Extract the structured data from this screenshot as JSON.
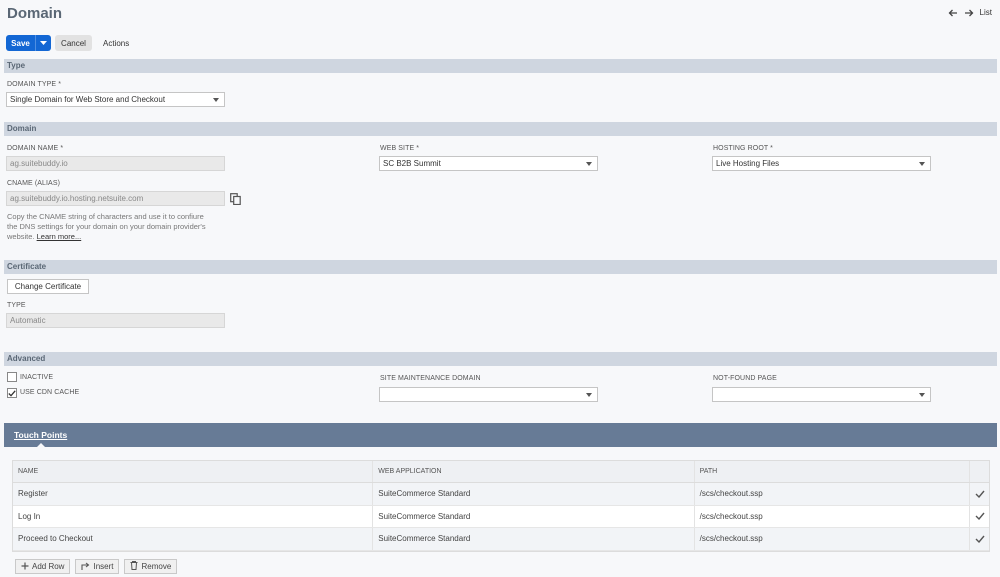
{
  "header": {
    "title": "Domain",
    "list_label": "List"
  },
  "toolbar": {
    "save_label": "Save",
    "cancel_label": "Cancel",
    "actions_label": "Actions"
  },
  "sections": {
    "type": {
      "title": "Type",
      "domain_type_label": "DOMAIN TYPE *",
      "domain_type_value": "Single Domain for Web Store and Checkout"
    },
    "domain": {
      "title": "Domain",
      "domain_name_label": "DOMAIN NAME *",
      "domain_name_value": "ag.suitebuddy.io",
      "cname_label": "CNAME (ALIAS)",
      "cname_value": "ag.suitebuddy.io.hosting.netsuite.com",
      "help_text": "Copy the CNAME string of characters and use it to confiure the DNS settings for your domain on your domain provider's website.",
      "help_link": "Learn more...",
      "website_label": "WEB SITE *",
      "website_value": "SC B2B Summit",
      "hosting_root_label": "HOSTING ROOT *",
      "hosting_root_value": "Live Hosting Files"
    },
    "certificate": {
      "title": "Certificate",
      "change_button": "Change Certificate",
      "type_label": "TYPE",
      "type_value": "Automatic"
    },
    "advanced": {
      "title": "Advanced",
      "inactive_label": "INACTIVE",
      "inactive_checked": false,
      "cdn_label": "USE CDN CACHE",
      "cdn_checked": true,
      "maintenance_label": "SITE MAINTENANCE DOMAIN",
      "maintenance_value": "",
      "notfound_label": "NOT-FOUND PAGE",
      "notfound_value": ""
    }
  },
  "touch_points": {
    "tab_label": "Touch Points",
    "columns": [
      "NAME",
      "WEB APPLICATION",
      "PATH"
    ],
    "rows": [
      {
        "name": "Register",
        "app": "SuiteCommerce Standard",
        "path": "/scs/checkout.ssp"
      },
      {
        "name": "Log In",
        "app": "SuiteCommerce Standard",
        "path": "/scs/checkout.ssp"
      },
      {
        "name": "Proceed to Checkout",
        "app": "SuiteCommerce Standard",
        "path": "/scs/checkout.ssp"
      }
    ],
    "actions": {
      "add_row": "Add Row",
      "insert": "Insert",
      "remove": "Remove"
    }
  },
  "colors": {
    "primary": "#1367d4",
    "section_bar": "#cfd6e0",
    "tab_bar": "#677b96"
  }
}
